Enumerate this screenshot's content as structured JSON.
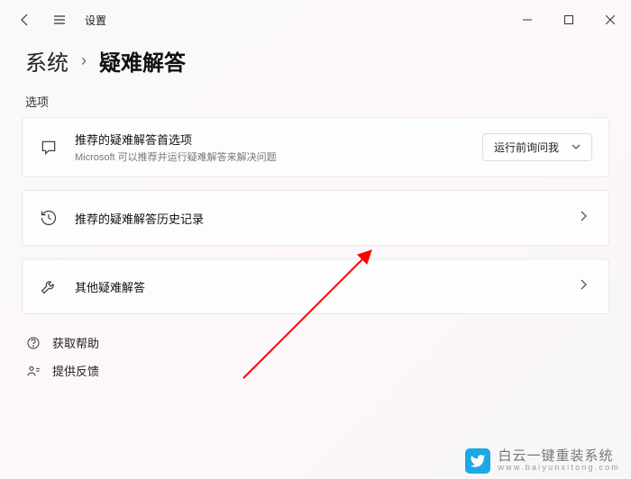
{
  "titlebar": {
    "title": "设置"
  },
  "breadcrumb": {
    "parent": "系统",
    "current": "疑难解答"
  },
  "section_label": "选项",
  "cards": {
    "recommended_pref": {
      "title": "推荐的疑难解答首选项",
      "subtitle": "Microsoft 可以推荐并运行疑难解答来解决问题",
      "dropdown_value": "运行前询问我"
    },
    "recommended_history": {
      "title": "推荐的疑难解答历史记录"
    },
    "other": {
      "title": "其他疑难解答"
    }
  },
  "links": {
    "help": "获取帮助",
    "feedback": "提供反馈"
  },
  "watermark": {
    "main": "白云一键重装系统",
    "sub": "www.baiyunxitong.com"
  }
}
